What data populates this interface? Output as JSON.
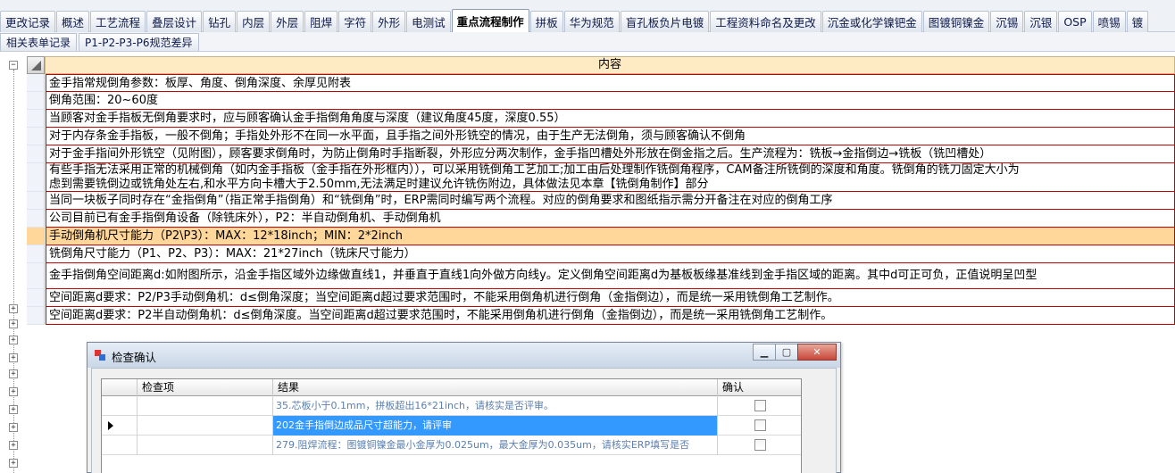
{
  "tabs_row1": [
    "更改记录",
    "概述",
    "工艺流程",
    "叠层设计",
    "钻孔",
    "内层",
    "外层",
    "阻焊",
    "字符",
    "外形",
    "电测试",
    "重点流程制作",
    "拼板",
    "华为规范",
    "盲孔板负片电镀",
    "工程资料命名及更改",
    "沉金或化学镍钯金",
    "图镀铜镍金",
    "沉锡",
    "沉银",
    "OSP",
    "喷锡",
    "镀"
  ],
  "active_tab_index": 11,
  "tabs_row2": [
    "相关表单记录",
    "P1-P2-P3-P6规范差异"
  ],
  "grid": {
    "header": "内容",
    "rows": [
      {
        "text": "金手指常规倒角参数：板厚、角度、倒角深度、余厚见附表"
      },
      {
        "text": "倒角范围：20~60度"
      },
      {
        "text": "当顾客对金手指板无倒角要求时，应与顾客确认金手指倒角角度与深度（建议角度45度，深度0.55）"
      },
      {
        "text": "对于内存条金手指板，一般不倒角；手指处外形不在同一水平面，且手指之间外形铣空的情况，由于生产无法倒角，须与顾客确认不倒角"
      },
      {
        "text": "对于金手指间外形铣空（见附图），顾客要求倒角时，为防止倒角时手指断裂，外形应分两次制作，金手指凹槽处外形放在倒金指之后。生产流程为：铣板→金指倒边→铣板（铣凹槽处）"
      },
      {
        "text": "有些手指无法采用正常的机械倒角（如内金手指板（金手指在外形框内）），可以采用铣倒角工艺加工;加工由后处理制作铣倒角程序，CAM备注所铣倒的深度和角度。铣倒角的铣刀固定大小为",
        "text2": "虑到需要铣倒边或铣角处左右,和水平方向卡槽大于2.50mm,无法满足时建议允许铣伤附边，具体做法见本章【铣倒角制作】部分"
      },
      {
        "text": "当同一块板子同时存在“金指倒角”（指正常手指倒角）和“铣倒角”时，ERP需同时编写两个流程。对应的倒角要求和图纸指示需分开备注在对应的倒角工序"
      },
      {
        "text": "公司目前已有金手指倒角设备（除铣床外），P2：半自动倒角机、手动倒角机"
      },
      {
        "text": "手动倒角机尺寸能力（P2\\P3）：MAX：12*18inch；MIN：2*2inch"
      },
      {
        "text": "铣倒角尺寸能力（P1、P2、P3）：MAX：21*27inch（铣床尺寸能力）"
      },
      {
        "text": "金手指倒角空间距离d:如附图所示，沿金手指区域外边缘做直线1，并垂直于直线1向外做方向线y。定义倒角空间距离d为基板板缘基准线到金手指区域的距离。其中d可正可负，正值说明呈凹型"
      },
      {
        "text": "空间距离d要求：P2/P3手动倒角机：d≤倒角深度；当空间距离d超过要求范围时，不能采用倒角机进行倒角（金指倒边），而是统一采用铣倒角工艺制作。"
      },
      {
        "text": "空间距离d要求：P2半自动倒角机：d≤倒角深度。当空间距离d超过要求范围时，不能采用倒角机进行倒角（金指倒边），而是统一采用铣倒角工艺制作。"
      }
    ],
    "highlight_index": 8
  },
  "dialog": {
    "title": "检查确认",
    "columns": [
      "检查项",
      "结果",
      "确认"
    ],
    "rows": [
      {
        "item": "",
        "result": "35.芯板小于0.1mm，拼板超出16*21inch，请核实是否评审。",
        "checked": false
      },
      {
        "item": "",
        "result": "202金手指倒边成品尺寸超能力，请评审",
        "checked": false
      },
      {
        "item": "",
        "result": "279.阻焊流程：图镀铜镍金最小金厚为0.025um，最大金厚为0.035um，请核实ERP填写是否",
        "checked": false
      }
    ],
    "selected_row": 1
  },
  "colors": {
    "row_border": "#c40000",
    "header_bg": "#ffebc3",
    "highlight_bg": "#ffd79a",
    "selection_blue": "#3399ff"
  }
}
